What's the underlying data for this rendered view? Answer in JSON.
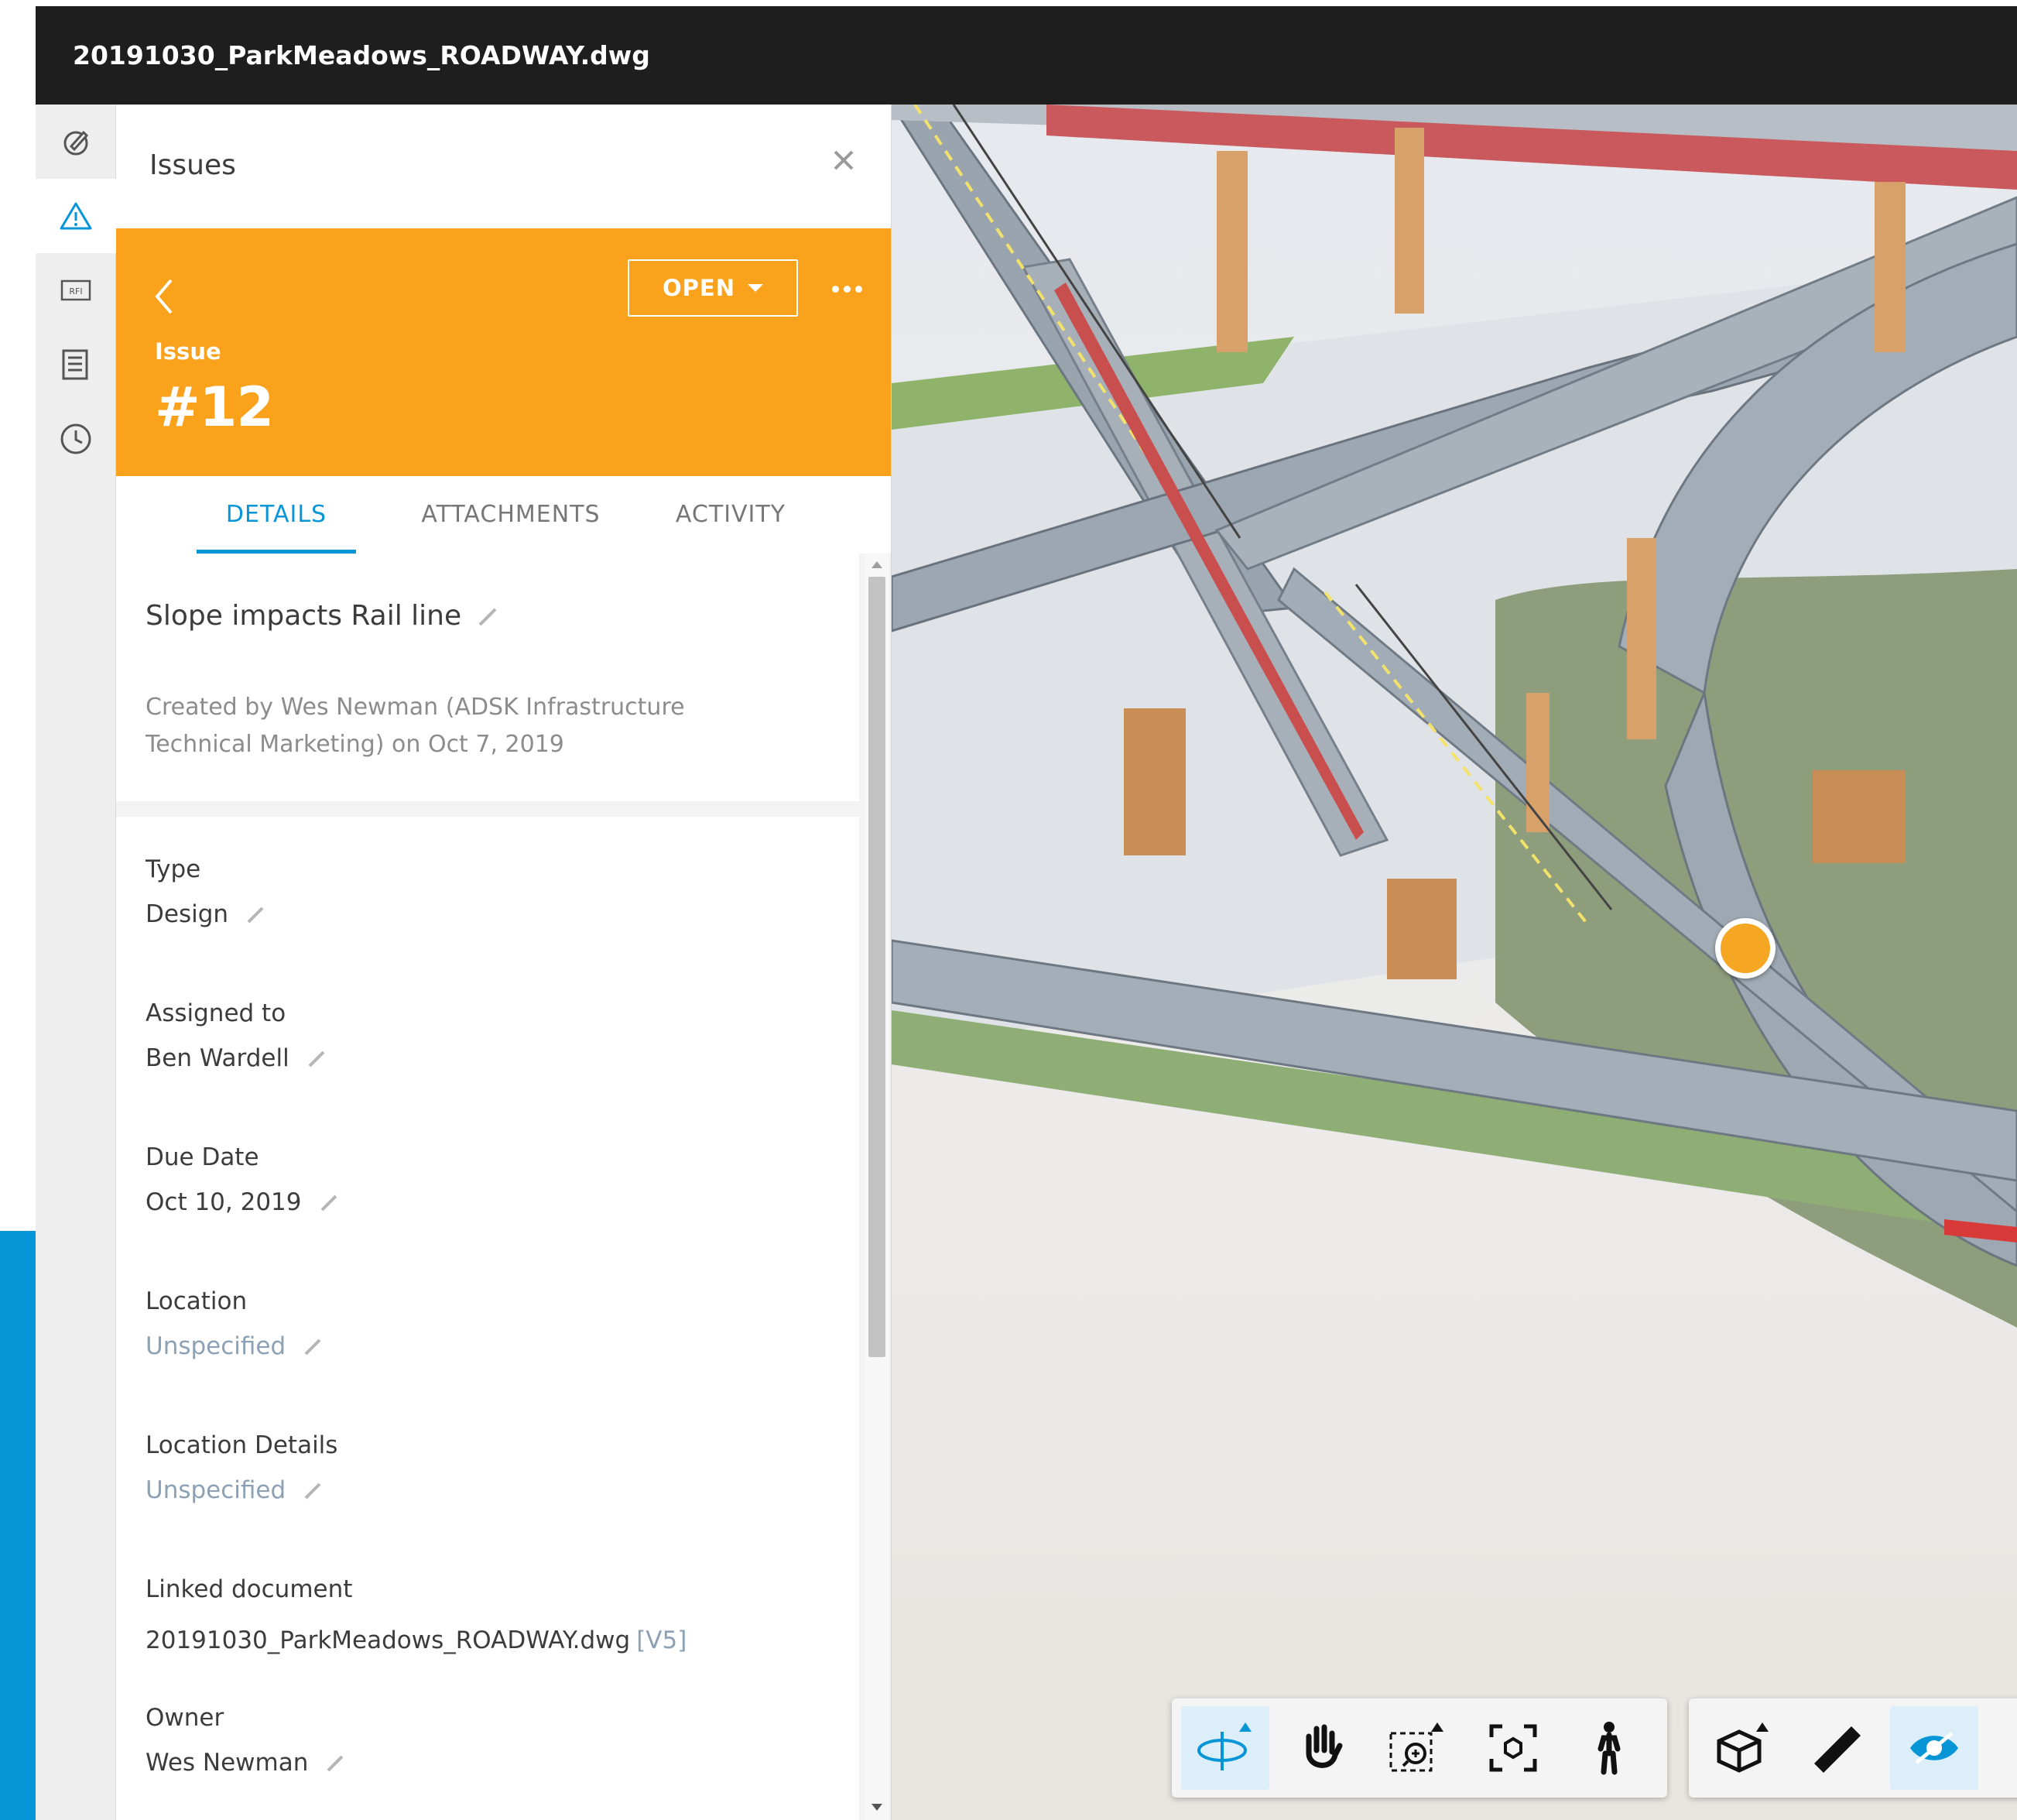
{
  "window": {
    "title": "20191030_ParkMeadows_ROADWAY.dwg"
  },
  "sidebar": {
    "items": [
      {
        "name": "markup-icon"
      },
      {
        "name": "issues-icon"
      },
      {
        "name": "rfi-icon",
        "text": "RFI"
      },
      {
        "name": "sheets-icon"
      },
      {
        "name": "history-icon"
      }
    ]
  },
  "panel": {
    "title": "Issues",
    "issue": {
      "label": "Issue",
      "number": "#12",
      "status": "OPEN",
      "header_color": "#faa21b"
    },
    "tabs": [
      {
        "label": "DETAILS",
        "active": true
      },
      {
        "label": "ATTACHMENTS",
        "active": false
      },
      {
        "label": "ACTIVITY",
        "active": false
      }
    ],
    "details": {
      "title": "Slope impacts Rail line",
      "created_by": "Created by Wes Newman (ADSK Infrastructure Technical Marketing) on Oct 7, 2019",
      "fields": {
        "type": {
          "label": "Type",
          "value": "Design"
        },
        "assigned_to": {
          "label": "Assigned to",
          "value": "Ben Wardell"
        },
        "due_date": {
          "label": "Due Date",
          "value": "Oct 10, 2019"
        },
        "location": {
          "label": "Location",
          "value": "Unspecified"
        },
        "location_details": {
          "label": "Location Details",
          "value": "Unspecified"
        },
        "linked_document": {
          "label": "Linked document",
          "value": "20191030_ParkMeadows_ROADWAY.dwg",
          "version": "[V5]"
        },
        "owner": {
          "label": "Owner",
          "value": "Wes Newman"
        }
      }
    }
  },
  "viewer": {
    "nav_tools": [
      "orbit-icon",
      "pan-icon",
      "zoom-window-icon",
      "fit-view-icon",
      "first-person-icon"
    ],
    "model_tools": [
      "model-browser-icon",
      "measure-icon",
      "explode-visibility-icon"
    ],
    "accent": "#0696d7"
  }
}
